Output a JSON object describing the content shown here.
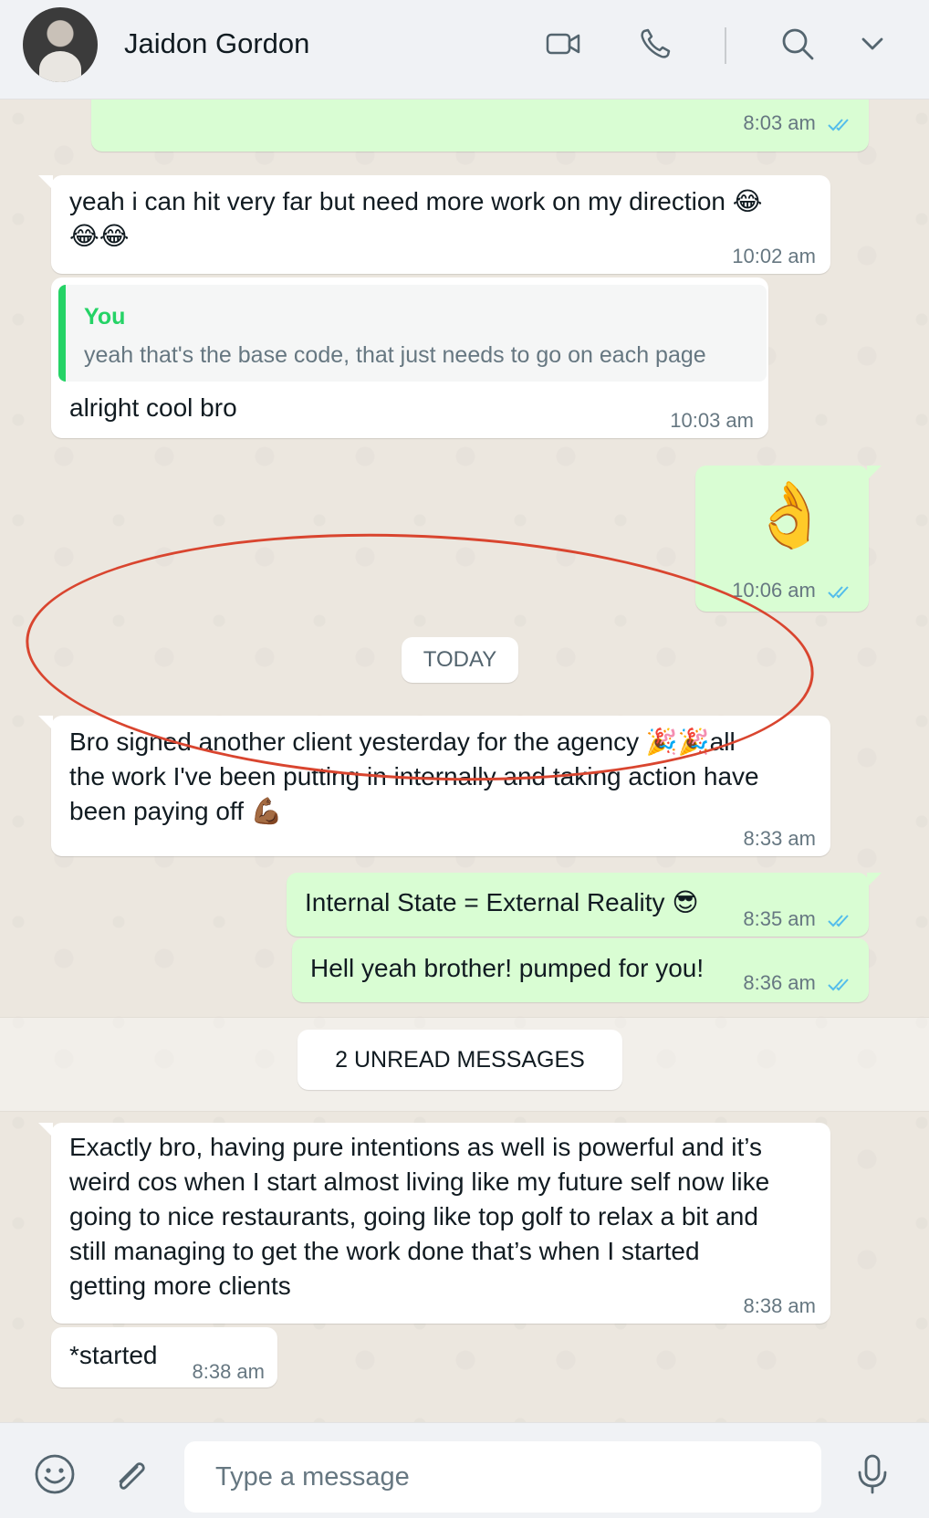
{
  "header": {
    "contact_name": "Jaidon Gordon",
    "icons": [
      "video-call-icon",
      "voice-call-icon",
      "search-icon",
      "chevron-down-icon"
    ]
  },
  "messages": [
    {
      "id": "m0",
      "direction": "outgoing",
      "time": "8:03 am",
      "read": true
    },
    {
      "id": "m1",
      "direction": "incoming",
      "lines": [
        "yeah i can hit very far but need more work on my direction 😂",
        "😂😂"
      ],
      "time": "10:02 am"
    },
    {
      "id": "m2",
      "direction": "incoming",
      "quote": {
        "author": "You",
        "text": "yeah that's the base code, that just needs to go on each page"
      },
      "text": "alright cool bro",
      "time": "10:03 am"
    },
    {
      "id": "m3",
      "direction": "outgoing",
      "text": "👌",
      "time": "10:06 am",
      "read": true
    },
    {
      "id": "m4",
      "direction": "incoming",
      "lines": [
        "Bro signed another client yesterday for the agency 🎉🎉all",
        "the work I've been putting in internally and taking action have",
        "been paying off 💪🏾"
      ],
      "time": "8:33 am"
    },
    {
      "id": "m5",
      "direction": "outgoing",
      "text": "Internal State = External Reality 😎",
      "time": "8:35 am",
      "read": true
    },
    {
      "id": "m6",
      "direction": "outgoing",
      "text": "Hell yeah brother! pumped for you!",
      "time": "8:36 am",
      "read": true
    },
    {
      "id": "m7",
      "direction": "incoming",
      "lines": [
        "Exactly bro, having pure intentions as well is powerful and it’s",
        "weird cos when I start almost living like my future self now like",
        "going to nice restaurants, going like top golf to relax a bit and",
        "still managing to get the work done that’s when I started",
        "getting more clients"
      ],
      "time": "8:38 am"
    },
    {
      "id": "m8",
      "direction": "incoming",
      "text": "*started",
      "time": "8:38 am"
    }
  ],
  "date_divider": "TODAY",
  "unread_divider": "2 UNREAD MESSAGES",
  "annotation": {
    "type": "hand-drawn ellipse",
    "color": "#d9452f",
    "target": "m4"
  },
  "footer": {
    "input_placeholder": "Type a message",
    "icons": [
      "emoji-icon",
      "attach-icon",
      "microphone-icon"
    ]
  },
  "colors": {
    "incoming_bubble": "#ffffff",
    "outgoing_bubble": "#d9fdd3",
    "read_ticks": "#53bdeb",
    "quote_accent": "#25d366",
    "chat_background": "#efeae2"
  }
}
